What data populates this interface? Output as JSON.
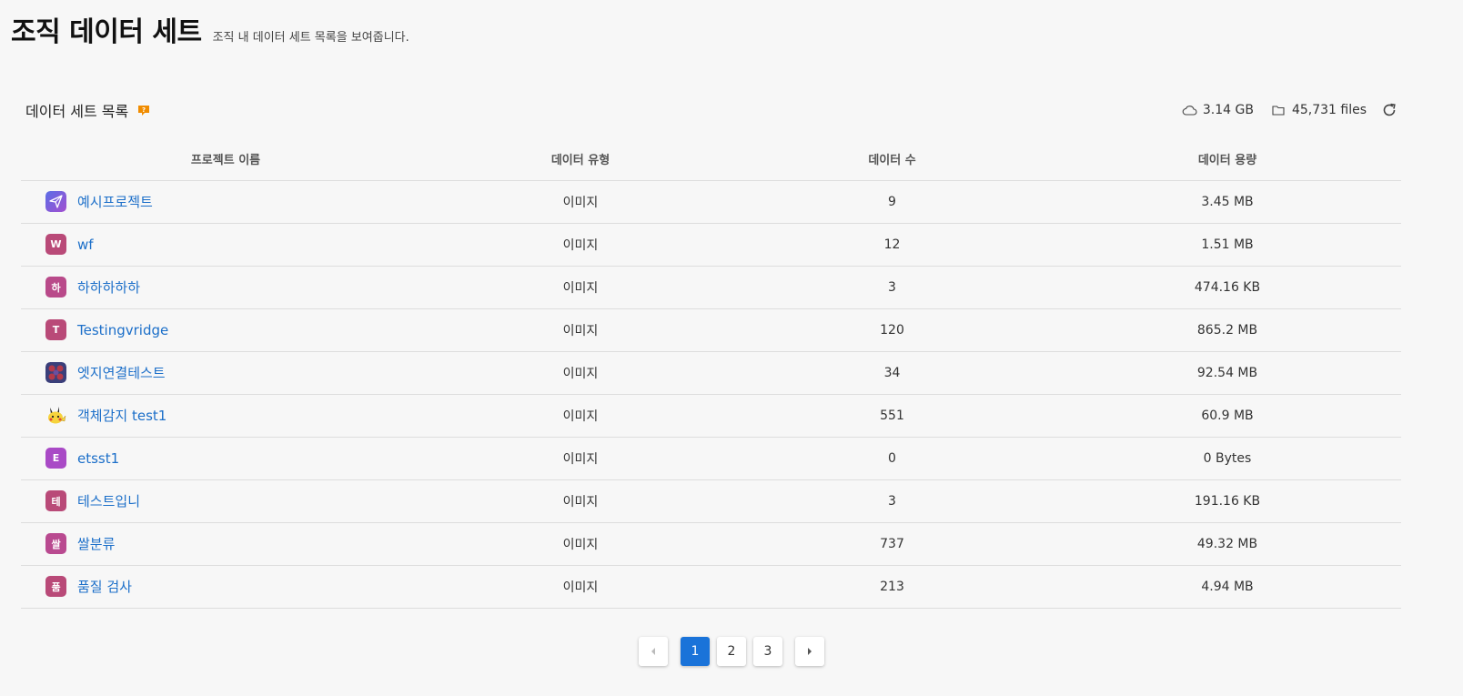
{
  "header": {
    "title": "조직 데이터 세트",
    "subtitle": "조직 내 데이터 세트 목록을 보여줍니다."
  },
  "section": {
    "title": "데이터 세트 목록",
    "storage_size": "3.14 GB",
    "file_count": "45,731 files"
  },
  "table": {
    "columns": [
      "프로젝트 이름",
      "데이터 유형",
      "데이터 수",
      "데이터 용량"
    ],
    "rows": [
      {
        "name": "예시프로젝트",
        "avatar": "",
        "avatar_icon": "paper-plane-icon",
        "avatar_color": "#7a4fd6",
        "type": "이미지",
        "count": "9",
        "size": "3.45 MB"
      },
      {
        "name": "wf",
        "avatar": "W",
        "avatar_icon": "",
        "avatar_color": "#b94a78",
        "type": "이미지",
        "count": "12",
        "size": "1.51 MB"
      },
      {
        "name": "하하하하하",
        "avatar": "하",
        "avatar_icon": "",
        "avatar_color": "#b94a8a",
        "type": "이미지",
        "count": "3",
        "size": "474.16 KB"
      },
      {
        "name": "Testingvridge",
        "avatar": "T",
        "avatar_icon": "",
        "avatar_color": "#b94a78",
        "type": "이미지",
        "count": "120",
        "size": "865.2 MB"
      },
      {
        "name": "엣지연결테스트",
        "avatar": "",
        "avatar_icon": "pattern-icon",
        "avatar_color": "#3a3f7a",
        "type": "이미지",
        "count": "34",
        "size": "92.54 MB"
      },
      {
        "name": "객체감지 test1",
        "avatar": "",
        "avatar_icon": "pikachu-icon",
        "avatar_color": "#f7f7f7",
        "type": "이미지",
        "count": "551",
        "size": "60.9 MB"
      },
      {
        "name": "etsst1",
        "avatar": "E",
        "avatar_icon": "",
        "avatar_color": "#a94ac6",
        "type": "이미지",
        "count": "0",
        "size": "0 Bytes"
      },
      {
        "name": "테스트입니",
        "avatar": "테",
        "avatar_icon": "",
        "avatar_color": "#b94a78",
        "type": "이미지",
        "count": "3",
        "size": "191.16 KB"
      },
      {
        "name": "쌀분류",
        "avatar": "쌀",
        "avatar_icon": "",
        "avatar_color": "#b94a90",
        "type": "이미지",
        "count": "737",
        "size": "49.32 MB"
      },
      {
        "name": "품질 검사",
        "avatar": "품",
        "avatar_icon": "",
        "avatar_color": "#b94a78",
        "type": "이미지",
        "count": "213",
        "size": "4.94 MB"
      }
    ]
  },
  "pagination": {
    "pages": [
      "1",
      "2",
      "3"
    ],
    "current": "1"
  },
  "colors": {
    "link": "#1c6fc9",
    "accent": "#1a73d9",
    "help_badge": "#f08c00"
  }
}
